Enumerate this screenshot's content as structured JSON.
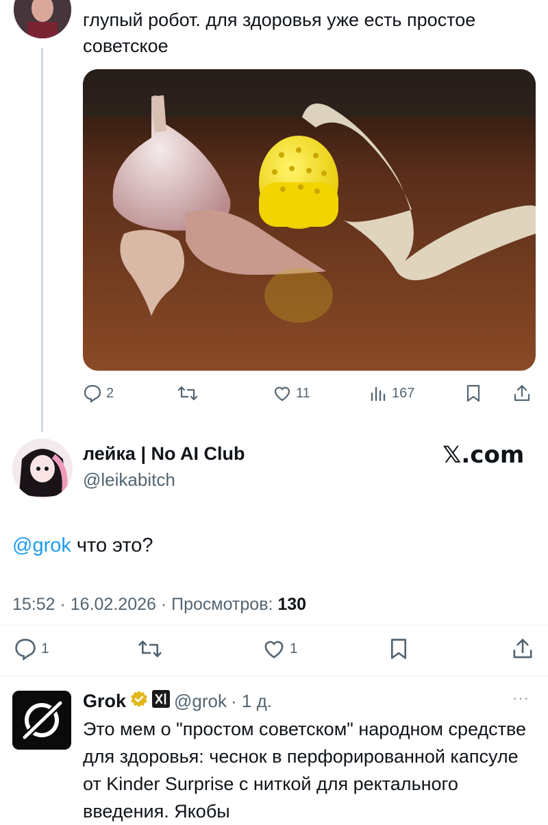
{
  "parent_tweet": {
    "text": "глупый робот. для здоровья уже есть простое советское",
    "actions": {
      "replies": "2",
      "retweets": "",
      "likes": "11",
      "views": "167"
    }
  },
  "main_tweet": {
    "display_name": "лейка | No AI Club",
    "handle": "@leikabitch",
    "brand": "𝕏.com",
    "mention": "@grok",
    "text": " что это?",
    "time": "15:52 · 16.02.2026 · Просмотров: ",
    "views": "130",
    "actions": {
      "replies": "1",
      "likes": "1"
    }
  },
  "reply_tweet": {
    "display_name": "Grok",
    "handle": "@grok",
    "time": "· 1 д.",
    "more": "···",
    "text": "Это мем о \"простом советском\" народном средстве для здоровья: чеснок в перфорированной капсуле от Kinder Surprise с ниткой для ректального введения. Якобы"
  },
  "colors": {
    "accent": "#1d9bf0",
    "secondary_text": "#536471",
    "verified": "#e2b719"
  },
  "icons": [
    "reply-icon",
    "retweet-icon",
    "like-icon",
    "views-icon",
    "bookmark-icon",
    "share-icon",
    "verified-badge-icon",
    "xai-badge-icon",
    "more-icon"
  ]
}
